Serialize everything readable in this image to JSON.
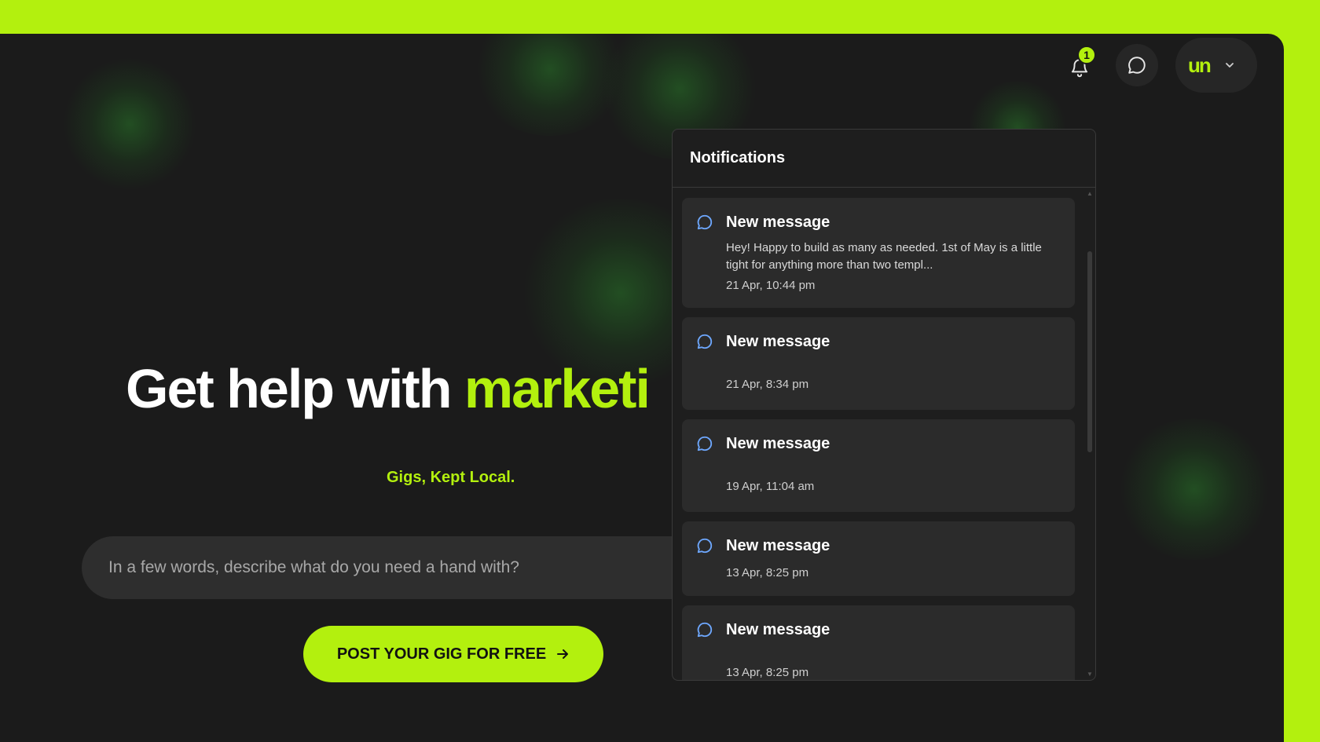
{
  "hero": {
    "title_prefix": "Get help with",
    "title_accent": "marketi",
    "tagline": "Gigs, Kept Local."
  },
  "search": {
    "placeholder": "In a few words, describe what do you need a hand with?"
  },
  "cta": {
    "label": "POST YOUR GIG FOR FREE",
    "icon": "arrow-right-icon"
  },
  "header": {
    "notification_count": "1",
    "logo_text": "un",
    "icons": [
      "bell-icon",
      "chat-icon",
      "chevron-down-icon"
    ]
  },
  "notifications": {
    "title": "Notifications",
    "items": [
      {
        "title": "New message",
        "body": "Hey! Happy to build as many as needed. 1st of May is a little tight for anything more than two templ...",
        "time": "21 Apr, 10:44 pm"
      },
      {
        "title": "New message",
        "body": "",
        "time": "21 Apr, 8:34 pm"
      },
      {
        "title": "New message",
        "body": "",
        "time": "19 Apr, 11:04 am"
      },
      {
        "title": "New message",
        "body": "",
        "time": "13 Apr, 8:25 pm"
      },
      {
        "title": "New message",
        "body": "",
        "time": "13 Apr, 8:25 pm"
      }
    ]
  },
  "colors": {
    "accent": "#b3f00e",
    "background": "#1b1b1b",
    "card": "#2b2b2b",
    "icon_blue": "#6ea8ff"
  }
}
